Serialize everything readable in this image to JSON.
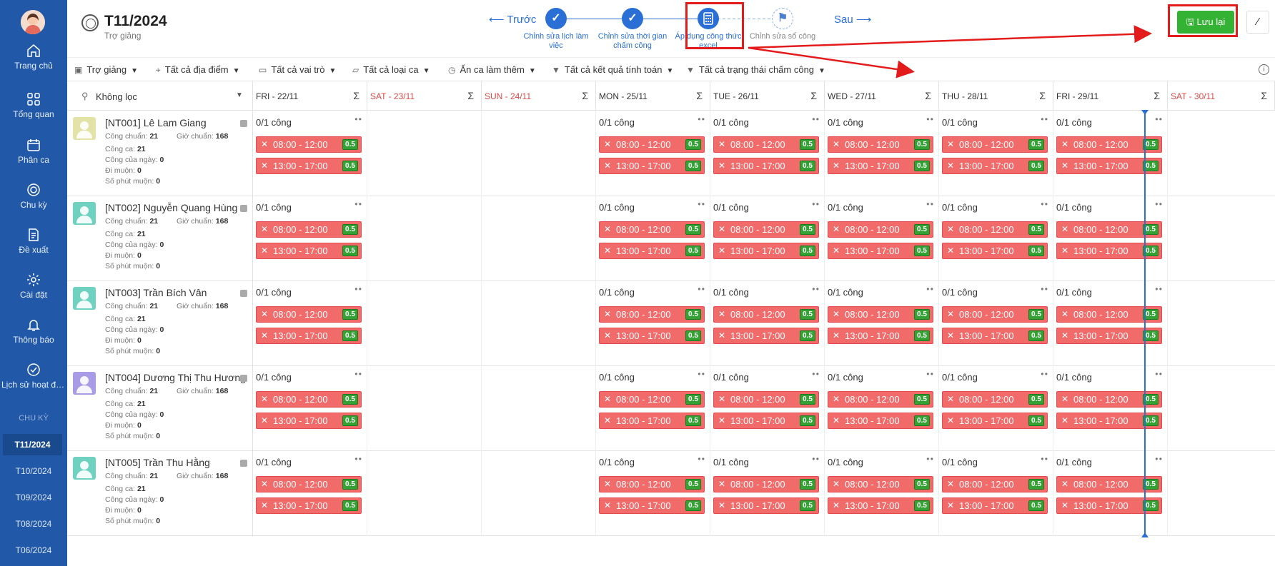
{
  "sidebar": {
    "items": [
      {
        "label": "Trang chủ",
        "icon": "home-icon"
      },
      {
        "label": "Tổng quan",
        "icon": "grid-icon"
      },
      {
        "label": "Phân ca",
        "icon": "calendar-icon"
      },
      {
        "label": "Chu kỳ",
        "icon": "cycle-icon"
      },
      {
        "label": "Đề xuất",
        "icon": "document-icon"
      },
      {
        "label": "Cài đặt",
        "icon": "gear-icon"
      },
      {
        "label": "Thông báo",
        "icon": "bell-icon"
      },
      {
        "label": "Lịch sử hoạt động",
        "icon": "check-icon"
      }
    ],
    "section_title": "CHU KỲ",
    "periods": [
      "T11/2024",
      "T10/2024",
      "T09/2024",
      "T08/2024",
      "T06/2024"
    ],
    "active_period": "T11/2024"
  },
  "header": {
    "title": "T11/2024",
    "subtitle": "Trợ giảng",
    "prev": "⟵ Trước",
    "next": "Sau ⟶",
    "save": "Lưu lại",
    "steps": [
      {
        "label": "Chỉnh sửa lịch làm việc",
        "state": "done"
      },
      {
        "label": "Chỉnh sửa thời gian chấm công",
        "state": "done"
      },
      {
        "label": "Áp dụng công thức excel",
        "state": "current"
      },
      {
        "label": "Chỉnh sửa sổ công",
        "state": "todo"
      }
    ]
  },
  "filters": [
    {
      "label": "Trợ giảng",
      "icon": "calendar-check-icon"
    },
    {
      "label": "Tất cả địa điểm",
      "icon": "location-icon"
    },
    {
      "label": "Tất cả vai trò",
      "icon": "briefcase-icon"
    },
    {
      "label": "Tất cả loại ca",
      "icon": "folder-icon"
    },
    {
      "label": "Ẩn ca làm thêm",
      "icon": "clock-icon"
    },
    {
      "label": "Tất cả kết quả tính toán",
      "icon": "filter-icon"
    },
    {
      "label": "Tất cả trạng thái chấm công",
      "icon": "filter-icon"
    }
  ],
  "grid": {
    "search_label": "Không lọc",
    "sum_symbol": "Σ",
    "days": [
      {
        "label": "FRI - 22/11",
        "weekend": false,
        "work": true
      },
      {
        "label": "SAT - 23/11",
        "weekend": true,
        "work": false
      },
      {
        "label": "SUN - 24/11",
        "weekend": true,
        "work": false
      },
      {
        "label": "MON - 25/11",
        "weekend": false,
        "work": true
      },
      {
        "label": "TUE - 26/11",
        "weekend": false,
        "work": true
      },
      {
        "label": "WED - 27/11",
        "weekend": false,
        "work": true
      },
      {
        "label": "THU - 28/11",
        "weekend": false,
        "work": true
      },
      {
        "label": "FRI - 29/11",
        "weekend": false,
        "work": true
      },
      {
        "label": "SAT - 30/11",
        "weekend": true,
        "work": false
      }
    ],
    "cell_status": "0/1 công",
    "shifts": [
      {
        "time": "08:00 - 12:00",
        "value": "0.5"
      },
      {
        "time": "13:00 - 17:00",
        "value": "0.5"
      }
    ],
    "stat_labels": {
      "cong_chuan": "Công chuẩn:",
      "gio_chuan": "Giờ chuẩn:",
      "cong_ca": "Công ca:",
      "cong_ngay": "Công của ngày:",
      "di_muon": "Đi muộn:",
      "phut_muon": "Số phút muộn:"
    },
    "employees": [
      {
        "name": "[NT001] Lê Lam Giang",
        "avatar_color": "#e3e3a8",
        "cong_chuan": "21",
        "gio_chuan": "168",
        "cong_ca": "21",
        "cong_ngay": "0",
        "di_muon": "0",
        "phut_muon": "0"
      },
      {
        "name": "[NT002] Nguyễn Quang Hùng",
        "avatar_color": "#6fd1bf",
        "cong_chuan": "21",
        "gio_chuan": "168",
        "cong_ca": "21",
        "cong_ngay": "0",
        "di_muon": "0",
        "phut_muon": "0"
      },
      {
        "name": "[NT003] Trần Bích Vân",
        "avatar_color": "#6fd1bf",
        "cong_chuan": "21",
        "gio_chuan": "168",
        "cong_ca": "21",
        "cong_ngay": "0",
        "di_muon": "0",
        "phut_muon": "0"
      },
      {
        "name": "[NT004] Dương Thị Thu Hương",
        "avatar_color": "#a99be6",
        "cong_chuan": "21",
        "gio_chuan": "168",
        "cong_ca": "21",
        "cong_ngay": "0",
        "di_muon": "0",
        "phut_muon": "0"
      },
      {
        "name": "[NT005] Trần Thu Hằng",
        "avatar_color": "#6fd1bf",
        "cong_chuan": "21",
        "gio_chuan": "168",
        "cong_ca": "21",
        "cong_ngay": "0",
        "di_muon": "0",
        "phut_muon": "0"
      }
    ]
  },
  "colors": {
    "sidebar": "#2159a8",
    "accent": "#2a6fd6",
    "shift_red": "#f26b6b",
    "badge_green": "#34a134",
    "save_green": "#34b233",
    "highlight": "#e31b1b"
  }
}
